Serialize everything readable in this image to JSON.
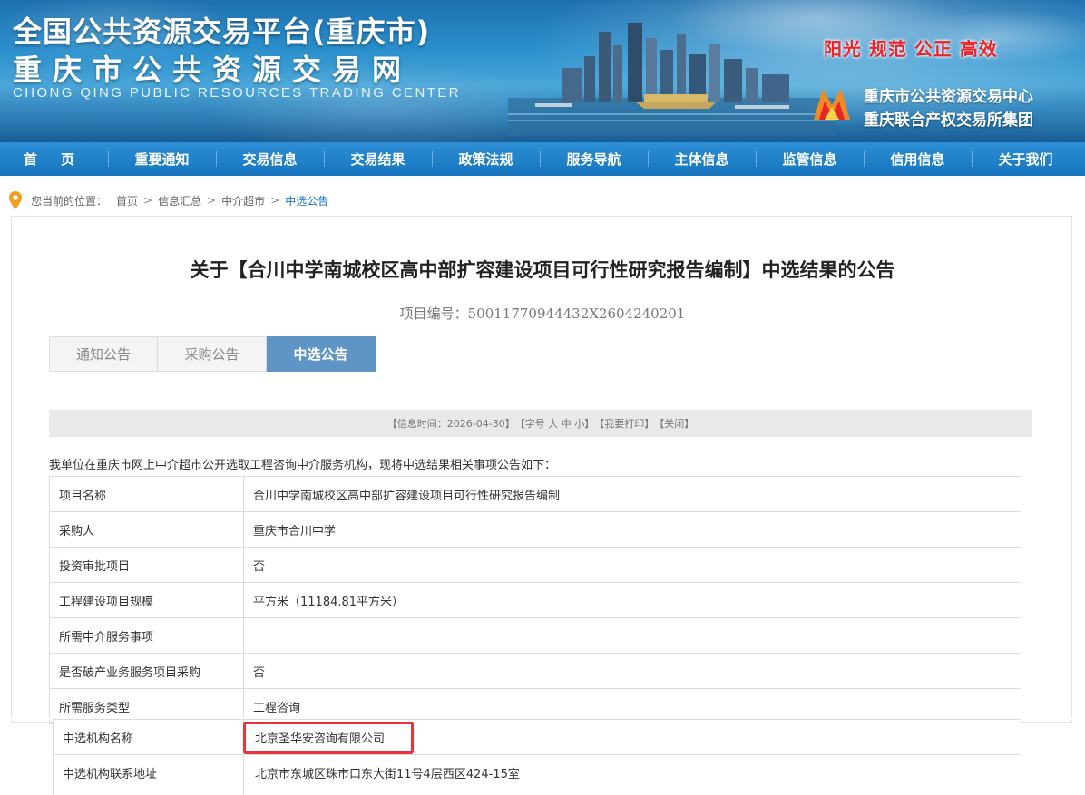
{
  "banner": {
    "title_line1": "全国公共资源交易平台(重庆市)",
    "title_line2": "重庆市公共资源交易网",
    "title_en": "CHONG QING PUBLIC RESOURCES TRADING CENTER",
    "slogan": "阳光  规范  公正  高效",
    "org_1": "重庆市公共资源交易中心",
    "org_2": "重庆联合产权交易所集团",
    "slogan_color": "#e8232a"
  },
  "nav": {
    "items": [
      "首页",
      "重要通知",
      "交易信息",
      "交易结果",
      "政策法规",
      "服务导航",
      "主体信息",
      "监管信息",
      "信用信息",
      "关于我们"
    ]
  },
  "breadcrumb": {
    "prefix": "您当前的位置：",
    "items": [
      "首页",
      "信息汇总",
      "中介超市",
      "中选公告"
    ],
    "separator": ">"
  },
  "document": {
    "title": "关于【合川中学南城校区高中部扩容建设项目可行性研究报告编制】中选结果的公告",
    "project_no": "项目编号：50011770944432X2604240201",
    "tabs": [
      "通知公告",
      "采购公告",
      "中选公告"
    ],
    "active_tab": "中选公告",
    "info_bar": {
      "time": "【信息时间：2026-04-30】",
      "font_size": "【字号 大 中 小】",
      "print": "【我要打印】",
      "close": "【关闭】"
    },
    "intro": "我单位在重庆市网上中介超市公开选取工程咨询中介服务机构，现将中选结果相关事项公告如下："
  },
  "table": {
    "rows": [
      {
        "key": "项目名称",
        "value": "合川中学南城校区高中部扩容建设项目可行性研究报告编制"
      },
      {
        "key": "采购人",
        "value": "重庆市合川中学"
      },
      {
        "key": "投资审批项目",
        "value": "否"
      },
      {
        "key": "工程建设项目规模",
        "value": "平方米（11184.81平方米）"
      },
      {
        "key": "所需中介服务事项",
        "value": ""
      },
      {
        "key": "是否破产业务服务项目采购",
        "value": "否"
      },
      {
        "key": "所需服务类型",
        "value": "工程咨询"
      }
    ]
  },
  "table2": {
    "rows": [
      {
        "key": "中选机构名称",
        "value": "北京圣华安咨询有限公司"
      },
      {
        "key": "中选机构联系地址",
        "value": "北京市东城区珠市口东大街11号4层西区424-15室"
      },
      {
        "key": "",
        "value": ""
      }
    ]
  },
  "colors": {
    "nav_bg": "#1574bd",
    "active_tab": "#5f95c5",
    "highlight": "#e8333c",
    "breadcrumb_current": "#1a73c8"
  }
}
